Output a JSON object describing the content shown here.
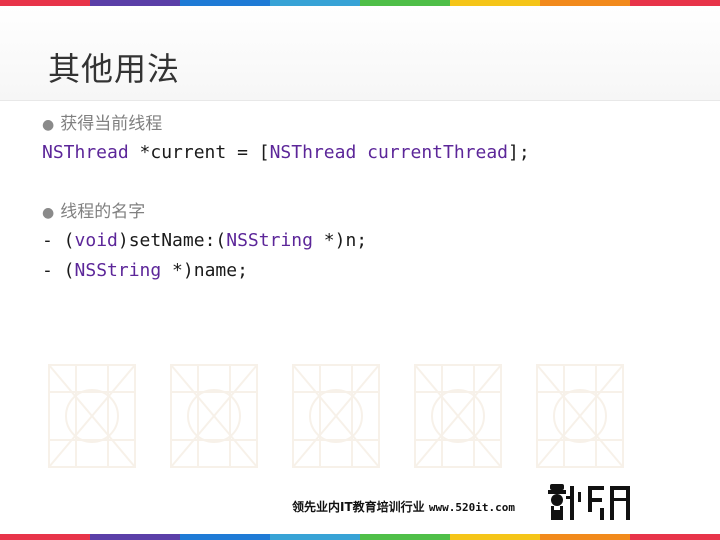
{
  "slide": {
    "title": "其他用法",
    "bullets": [
      {
        "text": "获得当前线程"
      },
      {
        "text": "线程的名字"
      }
    ],
    "code_current": {
      "t1": "NSThread",
      "t2": " *current = [",
      "t3": "NSThread",
      "t4": " ",
      "t5": "currentThread",
      "t6": "];"
    },
    "code_setname": {
      "t1": "- (",
      "t2": "void",
      "t3": ")setName:(",
      "t4": "NSString",
      "t5": " *)n;"
    },
    "code_name": {
      "t1": "- (",
      "t2": "NSString",
      "t3": " *)name;"
    },
    "bullet_glyph": "●"
  },
  "footer": {
    "text": "领先业内IT教育培训行业 ",
    "url": "www.520it.com"
  },
  "colors": {
    "stripe": [
      "#e8344a",
      "#5b3fa8",
      "#1f7bd6",
      "#38a3d6",
      "#4fbf48",
      "#f5c518",
      "#f28a1c",
      "#e8344a"
    ],
    "keyword": "#5c2699",
    "title": "#333333"
  },
  "icons": {
    "logo": "xiaoma-logo-icon",
    "watermark": "grid-watermark-icon"
  }
}
